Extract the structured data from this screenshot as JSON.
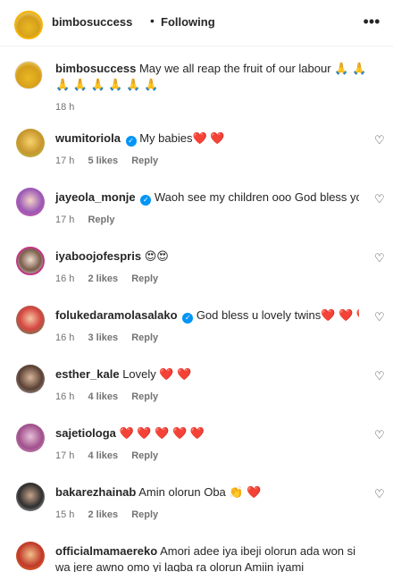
{
  "header": {
    "username": "bimbosuccess",
    "separator": "•",
    "follow_status": "Following",
    "more_icon": "more-horizontal-icon"
  },
  "caption": {
    "username": "bimbosuccess",
    "text": "May we all reap the fruit of our labour 🙏 🙏 🙏 🙏 🙏 🙏 🙏 🙏",
    "time": "18 h"
  },
  "comments": [
    {
      "username": "wumitoriola",
      "verified": true,
      "text": "My babies❤️ ❤️",
      "time": "17 h",
      "likes": "5 likes",
      "reply": "Reply"
    },
    {
      "username": "jayeola_monje",
      "verified": true,
      "text": "Waoh see my children ooo God bless you",
      "time": "17 h",
      "likes": "",
      "reply": "Reply"
    },
    {
      "username": "iyaboojofespris",
      "verified": false,
      "text": "😍😍",
      "time": "16 h",
      "likes": "2 likes",
      "reply": "Reply"
    },
    {
      "username": "folukedaramolasalako",
      "verified": true,
      "text": "God bless u lovely twins❤️ ❤️ ❤️",
      "time": "16 h",
      "likes": "3 likes",
      "reply": "Reply"
    },
    {
      "username": "esther_kale",
      "verified": false,
      "text": "Lovely ❤️ ❤️",
      "time": "16 h",
      "likes": "4 likes",
      "reply": "Reply"
    },
    {
      "username": "sajetiologa",
      "verified": false,
      "text": "❤️ ❤️ ❤️ ❤️ ❤️",
      "time": "17 h",
      "likes": "4 likes",
      "reply": "Reply"
    },
    {
      "username": "bakarezhainab",
      "verified": false,
      "text": "Amin olorun Oba 👏 ❤️",
      "time": "15 h",
      "likes": "2 likes",
      "reply": "Reply"
    },
    {
      "username": "officialmamaereko",
      "verified": false,
      "text": "Amori adee iya ibeji olorun ada won si wa jere awno omo yi laqba ra olorun Amiin iyami",
      "time": "",
      "likes": "",
      "reply": ""
    }
  ],
  "icons": {
    "like": "heart-outline-icon",
    "verified": "verified-badge-icon"
  },
  "colors": {
    "verified": "#0095f6",
    "heart_emoji": "#ed1c24",
    "meta_text": "#737373"
  }
}
